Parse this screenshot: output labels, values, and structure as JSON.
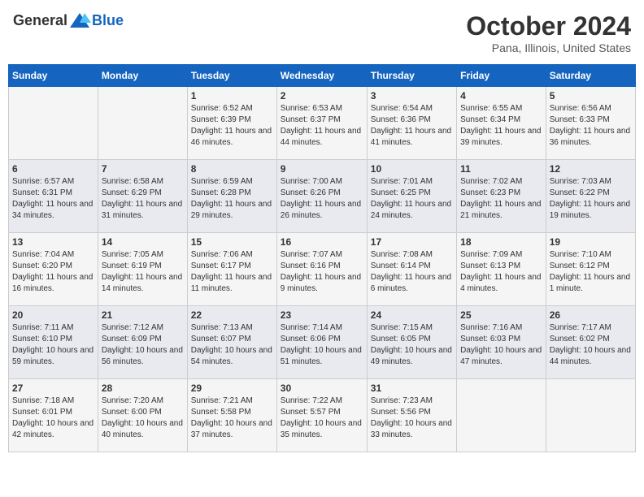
{
  "header": {
    "logo_general": "General",
    "logo_blue": "Blue",
    "month": "October 2024",
    "location": "Pana, Illinois, United States"
  },
  "days_of_week": [
    "Sunday",
    "Monday",
    "Tuesday",
    "Wednesday",
    "Thursday",
    "Friday",
    "Saturday"
  ],
  "weeks": [
    [
      {
        "day": "",
        "info": ""
      },
      {
        "day": "",
        "info": ""
      },
      {
        "day": "1",
        "info": "Sunrise: 6:52 AM\nSunset: 6:39 PM\nDaylight: 11 hours and 46 minutes."
      },
      {
        "day": "2",
        "info": "Sunrise: 6:53 AM\nSunset: 6:37 PM\nDaylight: 11 hours and 44 minutes."
      },
      {
        "day": "3",
        "info": "Sunrise: 6:54 AM\nSunset: 6:36 PM\nDaylight: 11 hours and 41 minutes."
      },
      {
        "day": "4",
        "info": "Sunrise: 6:55 AM\nSunset: 6:34 PM\nDaylight: 11 hours and 39 minutes."
      },
      {
        "day": "5",
        "info": "Sunrise: 6:56 AM\nSunset: 6:33 PM\nDaylight: 11 hours and 36 minutes."
      }
    ],
    [
      {
        "day": "6",
        "info": "Sunrise: 6:57 AM\nSunset: 6:31 PM\nDaylight: 11 hours and 34 minutes."
      },
      {
        "day": "7",
        "info": "Sunrise: 6:58 AM\nSunset: 6:29 PM\nDaylight: 11 hours and 31 minutes."
      },
      {
        "day": "8",
        "info": "Sunrise: 6:59 AM\nSunset: 6:28 PM\nDaylight: 11 hours and 29 minutes."
      },
      {
        "day": "9",
        "info": "Sunrise: 7:00 AM\nSunset: 6:26 PM\nDaylight: 11 hours and 26 minutes."
      },
      {
        "day": "10",
        "info": "Sunrise: 7:01 AM\nSunset: 6:25 PM\nDaylight: 11 hours and 24 minutes."
      },
      {
        "day": "11",
        "info": "Sunrise: 7:02 AM\nSunset: 6:23 PM\nDaylight: 11 hours and 21 minutes."
      },
      {
        "day": "12",
        "info": "Sunrise: 7:03 AM\nSunset: 6:22 PM\nDaylight: 11 hours and 19 minutes."
      }
    ],
    [
      {
        "day": "13",
        "info": "Sunrise: 7:04 AM\nSunset: 6:20 PM\nDaylight: 11 hours and 16 minutes."
      },
      {
        "day": "14",
        "info": "Sunrise: 7:05 AM\nSunset: 6:19 PM\nDaylight: 11 hours and 14 minutes."
      },
      {
        "day": "15",
        "info": "Sunrise: 7:06 AM\nSunset: 6:17 PM\nDaylight: 11 hours and 11 minutes."
      },
      {
        "day": "16",
        "info": "Sunrise: 7:07 AM\nSunset: 6:16 PM\nDaylight: 11 hours and 9 minutes."
      },
      {
        "day": "17",
        "info": "Sunrise: 7:08 AM\nSunset: 6:14 PM\nDaylight: 11 hours and 6 minutes."
      },
      {
        "day": "18",
        "info": "Sunrise: 7:09 AM\nSunset: 6:13 PM\nDaylight: 11 hours and 4 minutes."
      },
      {
        "day": "19",
        "info": "Sunrise: 7:10 AM\nSunset: 6:12 PM\nDaylight: 11 hours and 1 minute."
      }
    ],
    [
      {
        "day": "20",
        "info": "Sunrise: 7:11 AM\nSunset: 6:10 PM\nDaylight: 10 hours and 59 minutes."
      },
      {
        "day": "21",
        "info": "Sunrise: 7:12 AM\nSunset: 6:09 PM\nDaylight: 10 hours and 56 minutes."
      },
      {
        "day": "22",
        "info": "Sunrise: 7:13 AM\nSunset: 6:07 PM\nDaylight: 10 hours and 54 minutes."
      },
      {
        "day": "23",
        "info": "Sunrise: 7:14 AM\nSunset: 6:06 PM\nDaylight: 10 hours and 51 minutes."
      },
      {
        "day": "24",
        "info": "Sunrise: 7:15 AM\nSunset: 6:05 PM\nDaylight: 10 hours and 49 minutes."
      },
      {
        "day": "25",
        "info": "Sunrise: 7:16 AM\nSunset: 6:03 PM\nDaylight: 10 hours and 47 minutes."
      },
      {
        "day": "26",
        "info": "Sunrise: 7:17 AM\nSunset: 6:02 PM\nDaylight: 10 hours and 44 minutes."
      }
    ],
    [
      {
        "day": "27",
        "info": "Sunrise: 7:18 AM\nSunset: 6:01 PM\nDaylight: 10 hours and 42 minutes."
      },
      {
        "day": "28",
        "info": "Sunrise: 7:20 AM\nSunset: 6:00 PM\nDaylight: 10 hours and 40 minutes."
      },
      {
        "day": "29",
        "info": "Sunrise: 7:21 AM\nSunset: 5:58 PM\nDaylight: 10 hours and 37 minutes."
      },
      {
        "day": "30",
        "info": "Sunrise: 7:22 AM\nSunset: 5:57 PM\nDaylight: 10 hours and 35 minutes."
      },
      {
        "day": "31",
        "info": "Sunrise: 7:23 AM\nSunset: 5:56 PM\nDaylight: 10 hours and 33 minutes."
      },
      {
        "day": "",
        "info": ""
      },
      {
        "day": "",
        "info": ""
      }
    ]
  ]
}
